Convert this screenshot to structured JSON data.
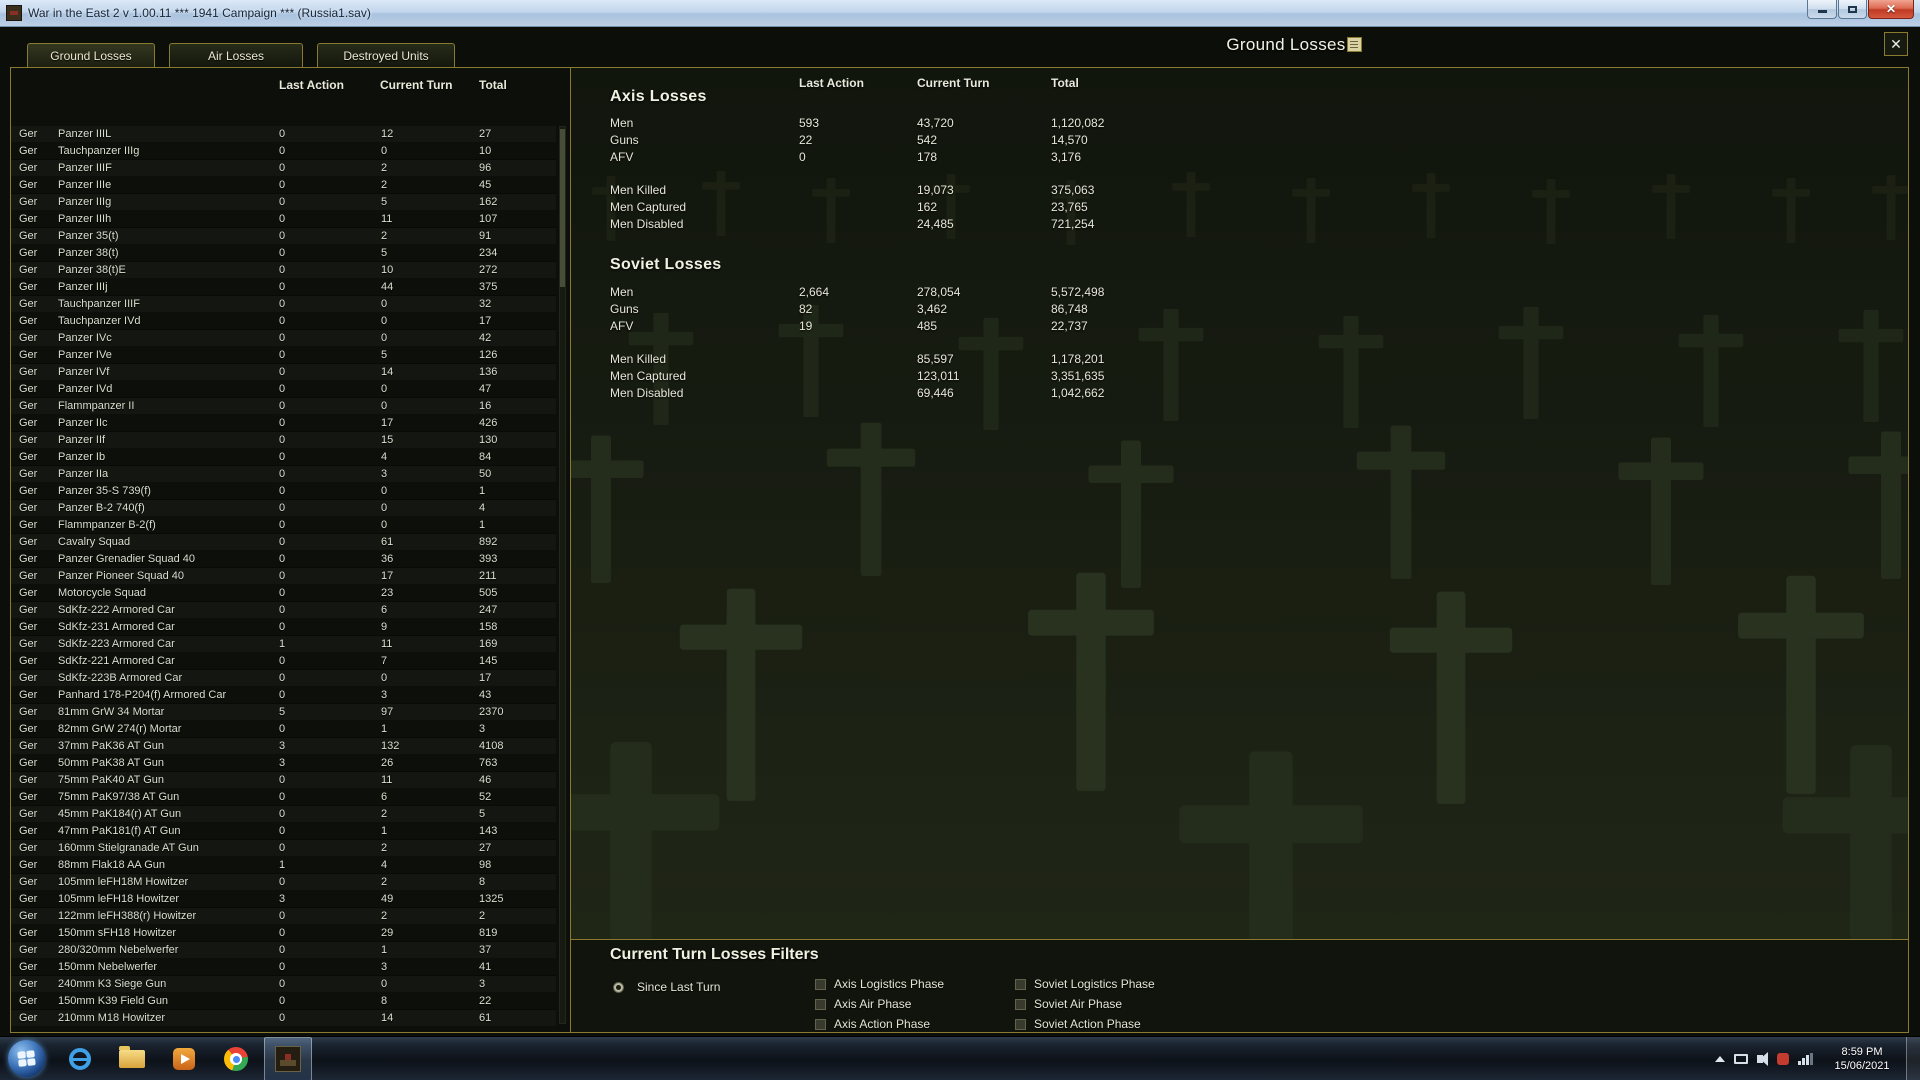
{
  "window": {
    "title": "War in the East 2  v 1.00.11     ***   1941 Campaign   ***    (Russia1.sav)"
  },
  "screen": {
    "title": "Ground Losses",
    "tabs": [
      "Ground Losses",
      "Air Losses",
      "Destroyed Units"
    ],
    "close_glyph": "✕"
  },
  "left_table": {
    "headers": [
      "Last Action",
      "Current Turn",
      "Total"
    ],
    "rows": [
      [
        "Ger",
        "Panzer IIIL",
        "0",
        "12",
        "27"
      ],
      [
        "Ger",
        "Tauchpanzer IIIg",
        "0",
        "0",
        "10"
      ],
      [
        "Ger",
        "Panzer IIIF",
        "0",
        "2",
        "96"
      ],
      [
        "Ger",
        "Panzer IIIe",
        "0",
        "2",
        "45"
      ],
      [
        "Ger",
        "Panzer IIIg",
        "0",
        "5",
        "162"
      ],
      [
        "Ger",
        "Panzer IIIh",
        "0",
        "11",
        "107"
      ],
      [
        "Ger",
        "Panzer 35(t)",
        "0",
        "2",
        "91"
      ],
      [
        "Ger",
        "Panzer 38(t)",
        "0",
        "5",
        "234"
      ],
      [
        "Ger",
        "Panzer 38(t)E",
        "0",
        "10",
        "272"
      ],
      [
        "Ger",
        "Panzer IIIj",
        "0",
        "44",
        "375"
      ],
      [
        "Ger",
        "Tauchpanzer IIIF",
        "0",
        "0",
        "32"
      ],
      [
        "Ger",
        "Tauchpanzer IVd",
        "0",
        "0",
        "17"
      ],
      [
        "Ger",
        "Panzer IVc",
        "0",
        "0",
        "42"
      ],
      [
        "Ger",
        "Panzer IVe",
        "0",
        "5",
        "126"
      ],
      [
        "Ger",
        "Panzer IVf",
        "0",
        "14",
        "136"
      ],
      [
        "Ger",
        "Panzer IVd",
        "0",
        "0",
        "47"
      ],
      [
        "Ger",
        "Flammpanzer II",
        "0",
        "0",
        "16"
      ],
      [
        "Ger",
        "Panzer IIc",
        "0",
        "17",
        "426"
      ],
      [
        "Ger",
        "Panzer IIf",
        "0",
        "15",
        "130"
      ],
      [
        "Ger",
        "Panzer Ib",
        "0",
        "4",
        "84"
      ],
      [
        "Ger",
        "Panzer IIa",
        "0",
        "3",
        "50"
      ],
      [
        "Ger",
        "Panzer 35-S 739(f)",
        "0",
        "0",
        "1"
      ],
      [
        "Ger",
        "Panzer B-2 740(f)",
        "0",
        "0",
        "4"
      ],
      [
        "Ger",
        "Flammpanzer B-2(f)",
        "0",
        "0",
        "1"
      ],
      [
        "Ger",
        "Cavalry Squad",
        "0",
        "61",
        "892"
      ],
      [
        "Ger",
        "Panzer Grenadier Squad 40",
        "0",
        "36",
        "393"
      ],
      [
        "Ger",
        "Panzer Pioneer Squad 40",
        "0",
        "17",
        "211"
      ],
      [
        "Ger",
        "Motorcycle Squad",
        "0",
        "23",
        "505"
      ],
      [
        "Ger",
        "SdKfz-222 Armored Car",
        "0",
        "6",
        "247"
      ],
      [
        "Ger",
        "SdKfz-231 Armored Car",
        "0",
        "9",
        "158"
      ],
      [
        "Ger",
        "SdKfz-223 Armored Car",
        "1",
        "11",
        "169"
      ],
      [
        "Ger",
        "SdKfz-221 Armored Car",
        "0",
        "7",
        "145"
      ],
      [
        "Ger",
        "SdKfz-223B Armored Car",
        "0",
        "0",
        "17"
      ],
      [
        "Ger",
        "Panhard 178-P204(f) Armored Car",
        "0",
        "3",
        "43"
      ],
      [
        "Ger",
        "81mm GrW 34 Mortar",
        "5",
        "97",
        "2370"
      ],
      [
        "Ger",
        "82mm GrW 274(r) Mortar",
        "0",
        "1",
        "3"
      ],
      [
        "Ger",
        "37mm PaK36 AT Gun",
        "3",
        "132",
        "4108"
      ],
      [
        "Ger",
        "50mm PaK38 AT Gun",
        "3",
        "26",
        "763"
      ],
      [
        "Ger",
        "75mm PaK40 AT Gun",
        "0",
        "11",
        "46"
      ],
      [
        "Ger",
        "75mm PaK97/38 AT Gun",
        "0",
        "6",
        "52"
      ],
      [
        "Ger",
        "45mm PaK184(r) AT Gun",
        "0",
        "2",
        "5"
      ],
      [
        "Ger",
        "47mm PaK181(f) AT Gun",
        "0",
        "1",
        "143"
      ],
      [
        "Ger",
        "160mm Stielgranade AT Gun",
        "0",
        "2",
        "27"
      ],
      [
        "Ger",
        "88mm Flak18 AA Gun",
        "1",
        "4",
        "98"
      ],
      [
        "Ger",
        "105mm leFH18M Howitzer",
        "0",
        "2",
        "8"
      ],
      [
        "Ger",
        "105mm leFH18 Howitzer",
        "3",
        "49",
        "1325"
      ],
      [
        "Ger",
        "122mm leFH388(r) Howitzer",
        "0",
        "2",
        "2"
      ],
      [
        "Ger",
        "150mm sFH18 Howitzer",
        "0",
        "29",
        "819"
      ],
      [
        "Ger",
        "280/320mm Nebelwerfer",
        "0",
        "1",
        "37"
      ],
      [
        "Ger",
        "150mm Nebelwerfer",
        "0",
        "3",
        "41"
      ],
      [
        "Ger",
        "240mm K3 Siege Gun",
        "0",
        "0",
        "3"
      ],
      [
        "Ger",
        "150mm K39 Field Gun",
        "0",
        "8",
        "22"
      ],
      [
        "Ger",
        "210mm M18 Howitzer",
        "0",
        "14",
        "61"
      ]
    ]
  },
  "summary": {
    "headers": [
      "Last Action",
      "Current Turn",
      "Total"
    ],
    "axis": {
      "title": "Axis Losses",
      "rows": [
        [
          "Men",
          "593",
          "43,720",
          "1,120,082"
        ],
        [
          "Guns",
          "22",
          "542",
          "14,570"
        ],
        [
          "AFV",
          "0",
          "178",
          "3,176"
        ],
        [
          "Men Killed",
          "",
          "19,073",
          "375,063"
        ],
        [
          "Men Captured",
          "",
          "162",
          "23,765"
        ],
        [
          "Men Disabled",
          "",
          "24,485",
          "721,254"
        ]
      ]
    },
    "soviet": {
      "title": "Soviet Losses",
      "rows": [
        [
          "Men",
          "2,664",
          "278,054",
          "5,572,498"
        ],
        [
          "Guns",
          "82",
          "3,462",
          "86,748"
        ],
        [
          "AFV",
          "19",
          "485",
          "22,737"
        ],
        [
          "Men Killed",
          "",
          "85,597",
          "1,178,201"
        ],
        [
          "Men Captured",
          "",
          "123,011",
          "3,351,635"
        ],
        [
          "Men Disabled",
          "",
          "69,446",
          "1,042,662"
        ]
      ]
    }
  },
  "filters": {
    "title": "Current Turn Losses Filters",
    "since_last_turn": "Since Last Turn",
    "since_last_turn_selected": true,
    "axis_phases": [
      "Axis Logistics Phase",
      "Axis Air Phase",
      "Axis Action Phase"
    ],
    "soviet_phases": [
      "Soviet Logistics Phase",
      "Soviet Air Phase",
      "Soviet Action Phase"
    ]
  },
  "taskbar": {
    "time": "8:59 PM",
    "date": "15/06/2021",
    "icons": [
      "start",
      "internet-explorer",
      "file-explorer",
      "media-player",
      "chrome",
      "war-in-the-east-active"
    ],
    "tray_icons": [
      "hidden-icons-chevron",
      "display",
      "volume",
      "antivirus",
      "network"
    ]
  },
  "colors": {
    "gold_accent": "#8a7a30",
    "panel_bg": "#0d100a",
    "text": "#e6e7d8",
    "close_red": "#c03a24"
  }
}
